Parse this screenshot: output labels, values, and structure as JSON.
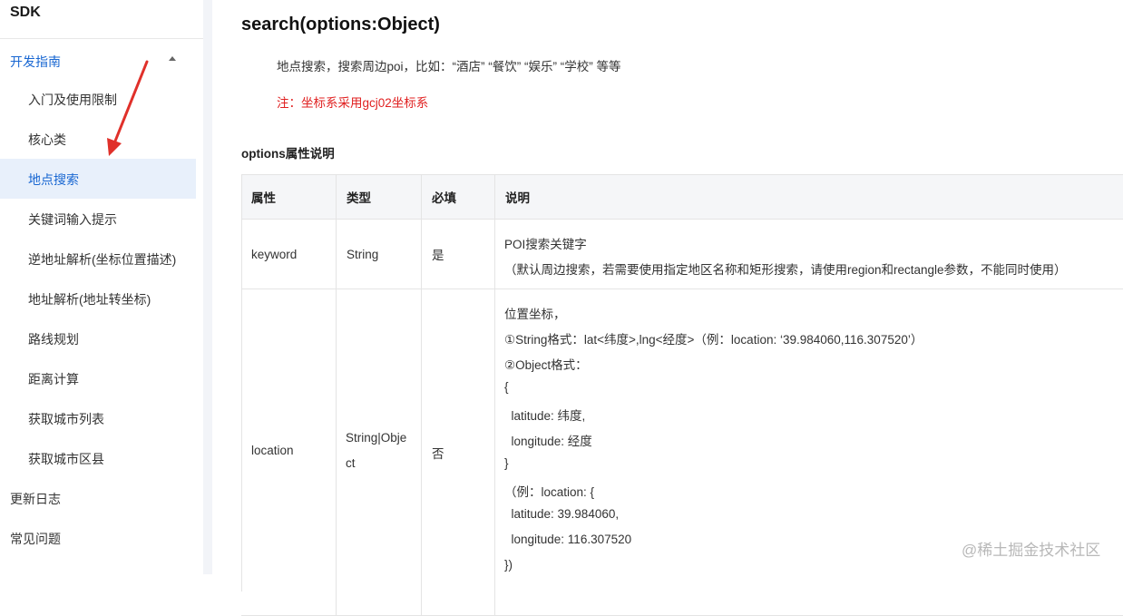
{
  "sidebar": {
    "title": "SDK",
    "group": {
      "label": "开发指南"
    },
    "items": [
      {
        "label": "入门及使用限制"
      },
      {
        "label": "核心类"
      },
      {
        "label": "地点搜索"
      },
      {
        "label": "关键词输入提示"
      },
      {
        "label": "逆地址解析(坐标位置描述)"
      },
      {
        "label": "地址解析(地址转坐标)"
      },
      {
        "label": "路线规划"
      },
      {
        "label": "距离计算"
      },
      {
        "label": "获取城市列表"
      },
      {
        "label": "获取城市区县"
      }
    ],
    "top_items": [
      {
        "label": "更新日志"
      },
      {
        "label": "常见问题"
      }
    ],
    "active_item": "地点搜索",
    "annotation": "red-arrow-pointing-to-active-item"
  },
  "main": {
    "title": "search(options:Object)",
    "description": "地点搜索，搜索周边poi，比如：“酒店” “餐饮” “娱乐” “学校” 等等",
    "note": "注：坐标系采用gcj02坐标系",
    "section_title": "options属性说明",
    "table": {
      "headers": [
        "属性",
        "类型",
        "必填",
        "说明"
      ],
      "rows": [
        {
          "name": "keyword",
          "type": "String",
          "required": "是",
          "desc": [
            "POI搜索关键字",
            "（默认周边搜索，若需要使用指定地区名称和矩形搜索，请使用region和rectangle参数，不能同时使用）"
          ]
        },
        {
          "name": "location",
          "type_lines": [
            "String|Obje",
            "ct"
          ],
          "required": "否",
          "desc": [
            "位置坐标，",
            "①String格式：lat<纬度>,lng<经度>（例：location: ‘39.984060,116.307520’）",
            "②Object格式：",
            "{",
            "  latitude: 纬度,",
            "  longitude: 经度",
            "}",
            "（例：location: {",
            "  latitude: 39.984060,",
            "  longitude: 116.307520",
            "})"
          ]
        }
      ]
    }
  },
  "watermark": "@稀土掘金技术社区",
  "colors": {
    "accent": "#1967d2",
    "note": "#e02020",
    "active_bg": "#e8f0fb",
    "arrow": "#e0302a"
  }
}
